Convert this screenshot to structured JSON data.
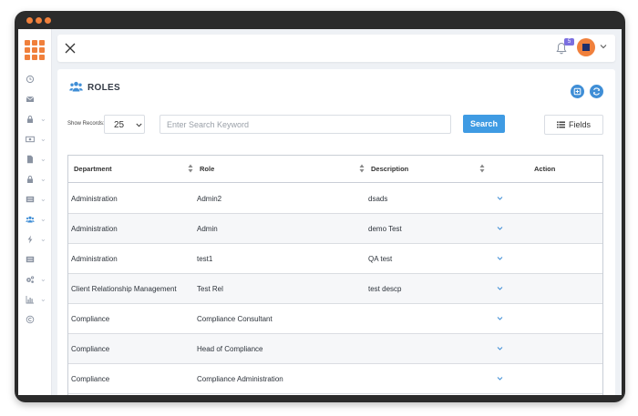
{
  "sidebar": {
    "items": [
      {
        "icon": "clock-icon",
        "has_submenu": false
      },
      {
        "icon": "envelope-icon",
        "has_submenu": false
      },
      {
        "icon": "lock-icon",
        "has_submenu": true
      },
      {
        "icon": "money-icon",
        "has_submenu": true
      },
      {
        "icon": "file-icon",
        "has_submenu": true
      },
      {
        "icon": "lock-icon",
        "has_submenu": true
      },
      {
        "icon": "list-icon",
        "has_submenu": true
      },
      {
        "icon": "users-icon",
        "has_submenu": true
      },
      {
        "icon": "bolt-icon",
        "has_submenu": true
      },
      {
        "icon": "list-icon",
        "has_submenu": false
      },
      {
        "icon": "cogs-icon",
        "has_submenu": true
      },
      {
        "icon": "bar-chart-icon",
        "has_submenu": true
      },
      {
        "icon": "copyright-icon",
        "has_submenu": false
      }
    ]
  },
  "topbar": {
    "notification_count": "5"
  },
  "page": {
    "title": "ROLES"
  },
  "controls": {
    "show_records_label": "Show Records:",
    "show_records_value": "25",
    "search_placeholder": "Enter Search Keyword",
    "search_button": "Search",
    "fields_button": "Fields"
  },
  "table": {
    "headers": {
      "department": "Department",
      "role": "Role",
      "description": "Description",
      "action": "Action"
    },
    "rows": [
      {
        "department": "Administration",
        "role": "Admin2",
        "description": "dsads"
      },
      {
        "department": "Administration",
        "role": "Admin",
        "description": "demo Test"
      },
      {
        "department": "Administration",
        "role": "test1",
        "description": "QA test"
      },
      {
        "department": "Client Relationship Management",
        "role": "Test Rel",
        "description": "test descp"
      },
      {
        "department": "Compliance",
        "role": "Compliance Consultant",
        "description": ""
      },
      {
        "department": "Compliance",
        "role": "Head of Compliance",
        "description": ""
      },
      {
        "department": "Compliance",
        "role": "Compliance Administration",
        "description": ""
      }
    ]
  },
  "colors": {
    "accent": "#f0803c",
    "primary": "#3f9be3",
    "badge": "#7b6fe0"
  }
}
